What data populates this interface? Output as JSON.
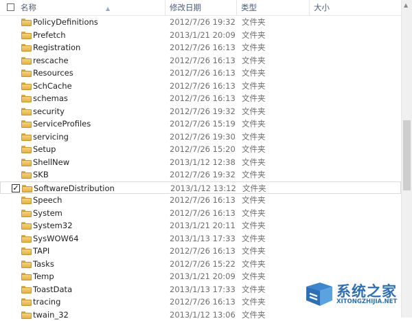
{
  "header": {
    "name": "名称",
    "date": "修改日期",
    "type": "类型",
    "size": "大小"
  },
  "rows": [
    {
      "name": "PolicyDefinitions",
      "date": "2012/7/26 19:32",
      "type": "文件夹",
      "checked": false
    },
    {
      "name": "Prefetch",
      "date": "2013/1/21 20:09",
      "type": "文件夹",
      "checked": false
    },
    {
      "name": "Registration",
      "date": "2012/7/26 16:13",
      "type": "文件夹",
      "checked": false
    },
    {
      "name": "rescache",
      "date": "2012/7/26 16:13",
      "type": "文件夹",
      "checked": false
    },
    {
      "name": "Resources",
      "date": "2012/7/26 16:13",
      "type": "文件夹",
      "checked": false
    },
    {
      "name": "SchCache",
      "date": "2012/7/26 16:13",
      "type": "文件夹",
      "checked": false
    },
    {
      "name": "schemas",
      "date": "2012/7/26 16:13",
      "type": "文件夹",
      "checked": false
    },
    {
      "name": "security",
      "date": "2012/7/26 19:32",
      "type": "文件夹",
      "checked": false
    },
    {
      "name": "ServiceProfiles",
      "date": "2012/7/26 15:19",
      "type": "文件夹",
      "checked": false
    },
    {
      "name": "servicing",
      "date": "2012/7/26 19:30",
      "type": "文件夹",
      "checked": false
    },
    {
      "name": "Setup",
      "date": "2012/7/26 15:20",
      "type": "文件夹",
      "checked": false
    },
    {
      "name": "ShellNew",
      "date": "2013/1/12 12:38",
      "type": "文件夹",
      "checked": false
    },
    {
      "name": "SKB",
      "date": "2012/7/26 19:32",
      "type": "文件夹",
      "checked": false
    },
    {
      "name": "SoftwareDistribution",
      "date": "2013/1/12 13:12",
      "type": "文件夹",
      "checked": true
    },
    {
      "name": "Speech",
      "date": "2012/7/26 16:13",
      "type": "文件夹",
      "checked": false
    },
    {
      "name": "System",
      "date": "2012/7/26 16:13",
      "type": "文件夹",
      "checked": false
    },
    {
      "name": "System32",
      "date": "2013/1/21 20:11",
      "type": "文件夹",
      "checked": false
    },
    {
      "name": "SysWOW64",
      "date": "2013/1/13 17:33",
      "type": "文件夹",
      "checked": false
    },
    {
      "name": "TAPI",
      "date": "2012/7/26 16:13",
      "type": "文件夹",
      "checked": false
    },
    {
      "name": "Tasks",
      "date": "2012/7/26 15:22",
      "type": "文件夹",
      "checked": false
    },
    {
      "name": "Temp",
      "date": "2013/1/21 20:09",
      "type": "文件夹",
      "checked": false
    },
    {
      "name": "ToastData",
      "date": "2013/1/13 17:33",
      "type": "文件夹",
      "checked": false
    },
    {
      "name": "tracing",
      "date": "2012/7/26 16:13",
      "type": "文件夹",
      "checked": false
    },
    {
      "name": "twain_32",
      "date": "2013/1/12 13:06",
      "type": "文件夹",
      "checked": false
    }
  ],
  "watermark": {
    "title": "系统之家",
    "subtitle": "XITONGZHIJIA.NET"
  },
  "colors": {
    "header_text": "#4c607a",
    "folder": "#e8b23f",
    "watermark": "#2d6fb8"
  }
}
